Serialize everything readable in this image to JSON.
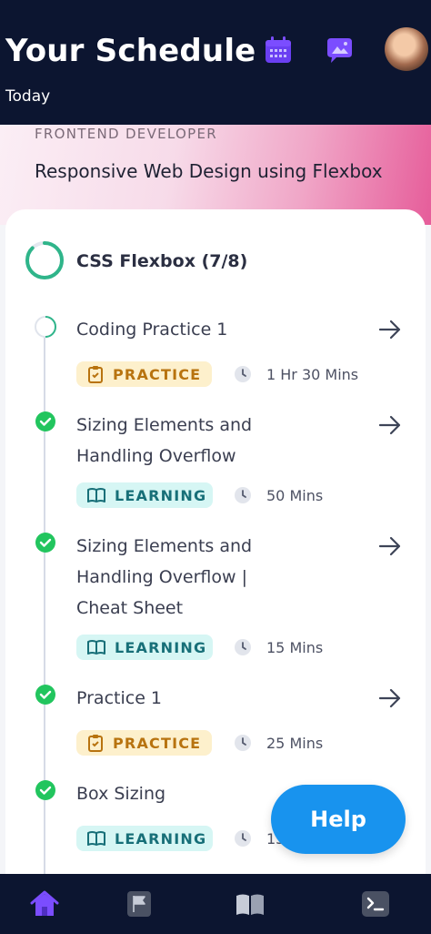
{
  "header": {
    "title": "Your Schedule",
    "subtitle": "Today",
    "calendar_icon": "calendar-icon",
    "chat_icon": "chat-bubble-icon",
    "accent": "#7b4dff"
  },
  "banner": {
    "role": "FRONTEND DEVELOPER",
    "course": "Responsive Web Design using Flexbox"
  },
  "module": {
    "title": "CSS Flexbox (7/8)",
    "progress_fraction": 0.875
  },
  "items": [
    {
      "title_lines": [
        "Coding Practice 1"
      ],
      "type": "PRACTICE",
      "duration": "1 Hr 30 Mins",
      "status": "in-progress"
    },
    {
      "title_lines": [
        "Sizing Elements and",
        "Handling Overflow"
      ],
      "type": "LEARNING",
      "duration": "50 Mins",
      "status": "completed"
    },
    {
      "title_lines": [
        "Sizing Elements and",
        "Handling Overflow |",
        "Cheat Sheet"
      ],
      "type": "LEARNING",
      "duration": "15 Mins",
      "status": "completed"
    },
    {
      "title_lines": [
        "Practice 1"
      ],
      "type": "PRACTICE",
      "duration": "25 Mins",
      "status": "completed"
    },
    {
      "title_lines": [
        "Box Sizing"
      ],
      "type": "LEARNING",
      "duration": "15 Mins",
      "status": "completed"
    }
  ],
  "help": {
    "label": "Help"
  },
  "nav": {
    "items": [
      "home-icon",
      "flag-icon",
      "book-icon",
      "terminal-icon"
    ],
    "active_color": "#7b4dff"
  },
  "colors": {
    "complete": "#22c55e",
    "practice_text": "#b8730f",
    "learning_text": "#176f78"
  }
}
